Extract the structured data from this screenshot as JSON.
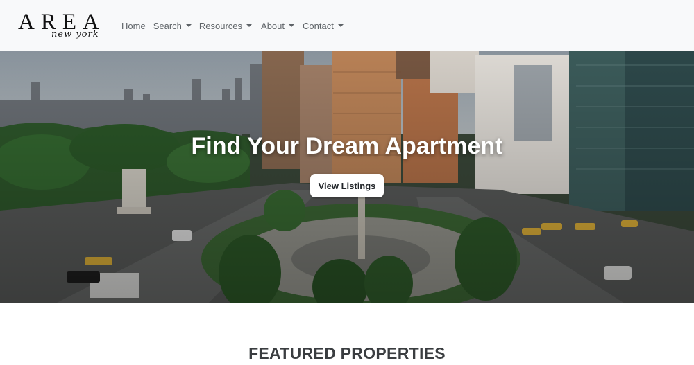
{
  "brand": {
    "name": "AREA",
    "tagline": "new york"
  },
  "nav": {
    "items": [
      {
        "label": "Home",
        "has_dropdown": false
      },
      {
        "label": "Search",
        "has_dropdown": true
      },
      {
        "label": "Resources",
        "has_dropdown": true
      },
      {
        "label": "About",
        "has_dropdown": true
      },
      {
        "label": "Contact",
        "has_dropdown": true
      }
    ]
  },
  "hero": {
    "title": "Find Your Dream Apartment",
    "button_label": "View Listings",
    "image_icon": "city-skyline-photo"
  },
  "featured": {
    "title": "FEATURED PROPERTIES"
  },
  "colors": {
    "navbar_bg": "#f8f9fa",
    "nav_text": "#5f6468",
    "heading": "#3a3d40",
    "button_bg": "#ffffff"
  }
}
